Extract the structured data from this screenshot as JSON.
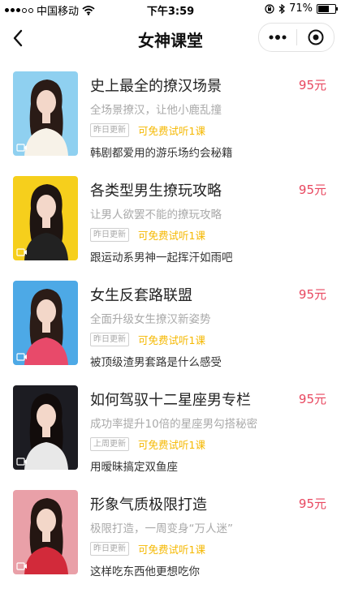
{
  "status_bar": {
    "carrier": "中国移动",
    "time": "下午3:59",
    "battery": "71%",
    "battery_level": 0.71
  },
  "nav": {
    "title": "女神课堂"
  },
  "courses": [
    {
      "title": "史上最全的撩汉场景",
      "price": "95元",
      "subtitle": "全场景撩汉，让他小鹿乱撞",
      "badge": "昨日更新",
      "trial": "可免费试听1课",
      "description": "韩剧都爱用的游乐场约会秘籍",
      "bg": "#8fd0f0",
      "accent": "#f7f2e8",
      "hair": "#2a1b16"
    },
    {
      "title": "各类型男生撩玩攻略",
      "price": "95元",
      "subtitle": "让男人欲罢不能的撩玩攻略",
      "badge": "昨日更新",
      "trial": "可免费试听1课",
      "description": "跟运动系男神一起挥汗如雨吧",
      "bg": "#f6cf1c",
      "accent": "#222222",
      "hair": "#1e1512"
    },
    {
      "title": "女生反套路联盟",
      "price": "95元",
      "subtitle": "全面升级女生撩汉新姿势",
      "badge": "昨日更新",
      "trial": "可免费试听1课",
      "description": "被顶级渣男套路是什么感受",
      "bg": "#4da9e6",
      "accent": "#e84a6a",
      "hair": "#2b1c17"
    },
    {
      "title": "如何驾驭十二星座男专栏",
      "price": "95元",
      "subtitle": "成功率提升10倍的星座男勾搭秘密",
      "badge": "上周更新",
      "trial": "可免费试听1课",
      "description": "用暧昧搞定双鱼座",
      "bg": "#1c1c22",
      "accent": "#e8e8e8",
      "hair": "#120c0b"
    },
    {
      "title": "形象气质极限打造",
      "price": "95元",
      "subtitle": "极限打造，一周变身“万人迷”",
      "badge": "昨日更新",
      "trial": "可免费试听1课",
      "description": "这样吃东西他更想吃你",
      "bg": "#e9a0a8",
      "accent": "#d22a3a",
      "hair": "#241612"
    }
  ]
}
